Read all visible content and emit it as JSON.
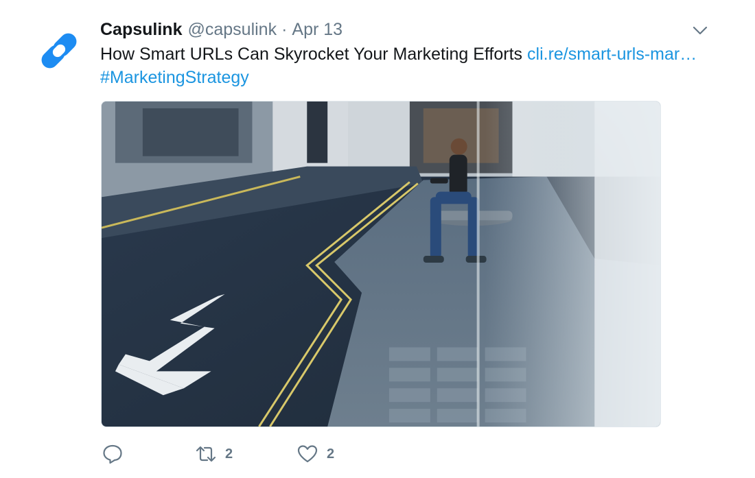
{
  "tweet": {
    "author": {
      "display_name": "Capsulink",
      "handle": "@capsulink",
      "avatar_icon": "chain-link-icon",
      "avatar_color": "#1d8cf2"
    },
    "separator": "·",
    "timestamp": "Apr 13",
    "text": "How Smart URLs Can Skyrocket Your Marketing Efforts",
    "link": "cli.re/smart-urls-mar…",
    "hashtag": "#MarketingStrategy",
    "link_color": "#1b95e0",
    "media": {
      "kind": "photo",
      "icon": "street-photo-image"
    },
    "actions": {
      "reply": {
        "icon": "reply-icon",
        "count": ""
      },
      "retweet": {
        "icon": "retweet-icon",
        "count": "2"
      },
      "like": {
        "icon": "heart-icon",
        "count": "2"
      }
    },
    "menu_icon": "chevron-down-icon"
  }
}
